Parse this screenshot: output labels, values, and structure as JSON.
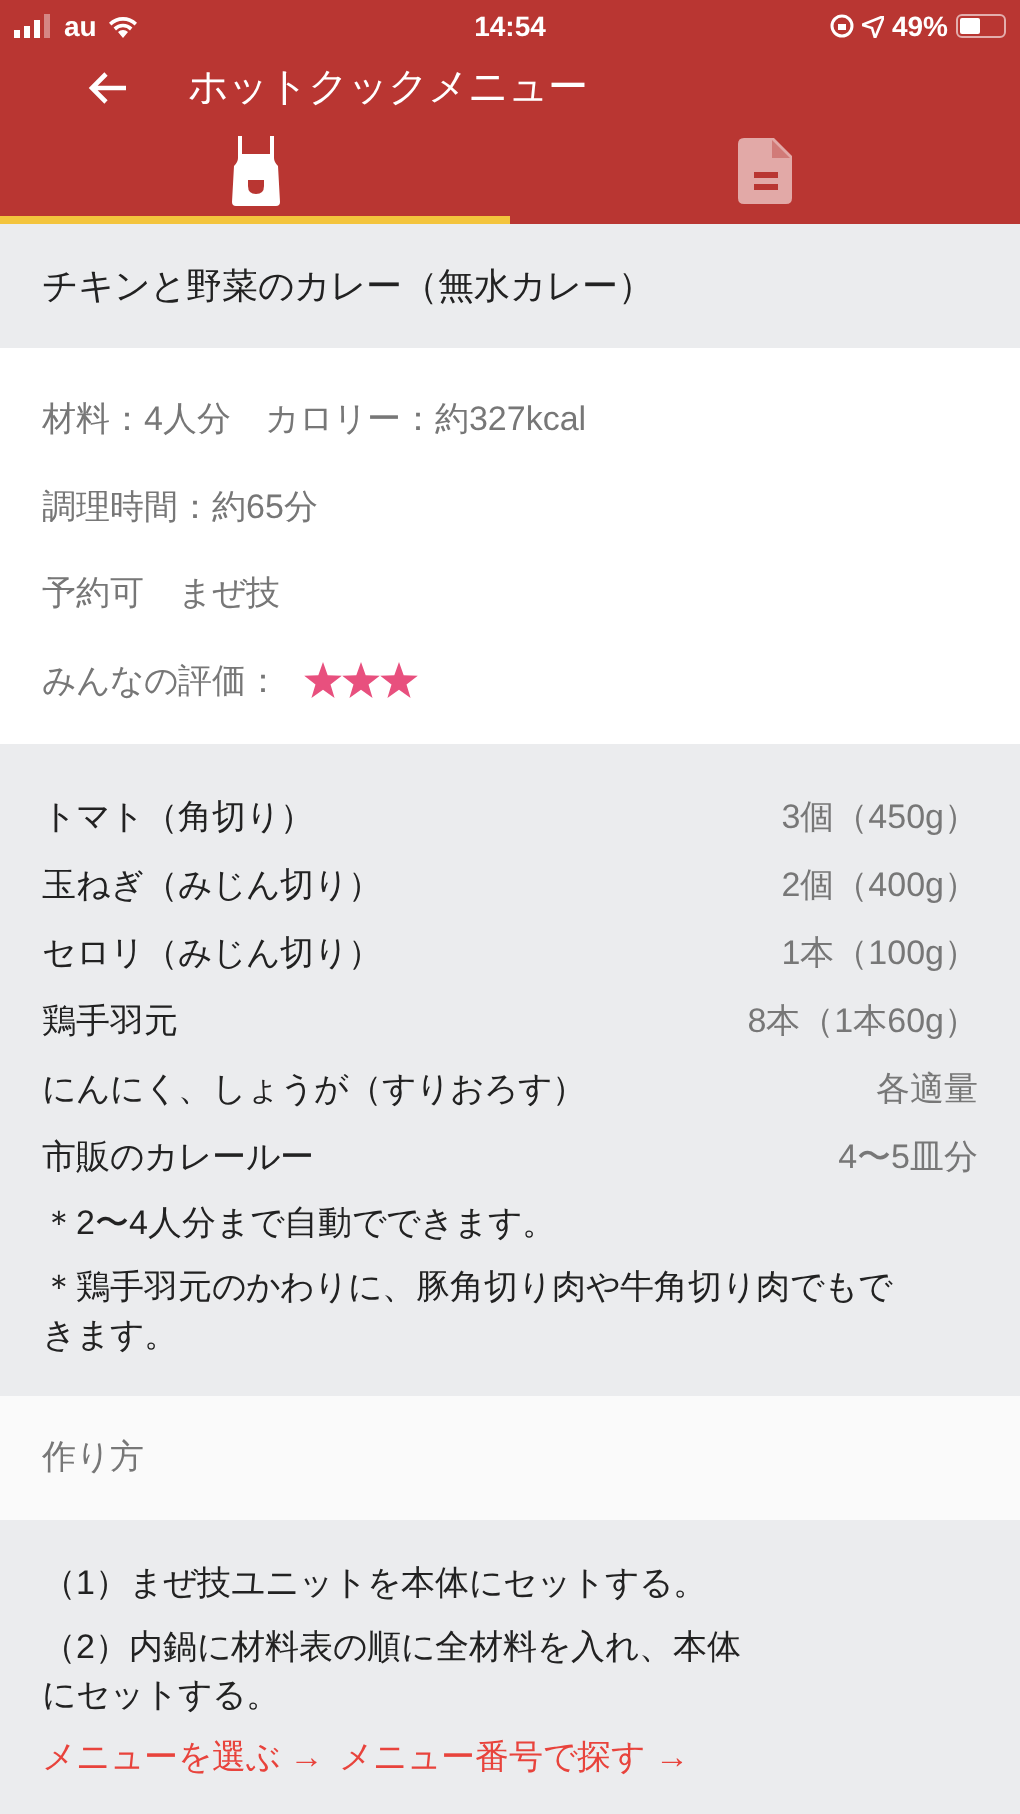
{
  "status_bar": {
    "carrier": "au",
    "time": "14:54",
    "battery": "49%"
  },
  "header": {
    "title": "ホットクックメニュー"
  },
  "tabs": [
    {
      "kind": "apron",
      "selected": true
    },
    {
      "kind": "document",
      "selected": false
    }
  ],
  "recipe": {
    "title": "チキンと野菜のカレー（無水カレー）",
    "info": [
      "材料：4人分　カロリー：約327kcal",
      "調理時間：約65分",
      "予約可　まぜ技"
    ],
    "rating": {
      "label": "みんなの評価：",
      "stars": 3
    }
  },
  "ingredients": [
    {
      "name": "トマト（角切り）",
      "amount": "3個（450g）"
    },
    {
      "name": "玉ねぎ（みじん切り）",
      "amount": "2個（400g）"
    },
    {
      "name": "セロリ（みじん切り）",
      "amount": "1本（100g）"
    },
    {
      "name": "鶏手羽元",
      "amount": "8本（1本60g）"
    },
    {
      "name": "にんにく、しょうが（すりおろす）",
      "amount": "各適量"
    },
    {
      "name": "市販のカレールー",
      "amount": "4〜5皿分"
    }
  ],
  "notes": [
    "＊2〜4人分まで自動でできます。",
    "＊鶏手羽元のかわりに、豚角切り肉や牛角切り肉でもできます。"
  ],
  "method": {
    "heading": "作り方",
    "steps": [
      "（1）まぜ技ユニットを本体にセットする。",
      "（2）内鍋に材料表の順に全材料を入れ、本体にセットする。"
    ],
    "links": [
      "メニューを選ぶ →",
      "メニュー番号で探す →"
    ]
  }
}
